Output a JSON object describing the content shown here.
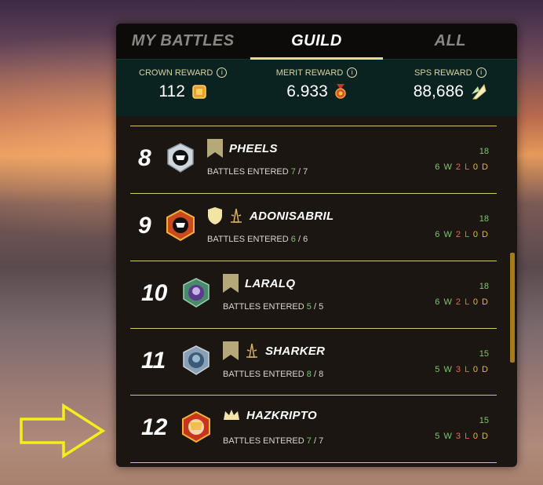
{
  "tabs": [
    {
      "label": "MY BATTLES"
    },
    {
      "label": "GUILD"
    },
    {
      "label": "ALL"
    }
  ],
  "rewards": {
    "crown": {
      "title": "CROWN REWARD",
      "value": "112"
    },
    "merit": {
      "title": "MERIT REWARD",
      "value": "6.933"
    },
    "sps": {
      "title": "SPS REWARD",
      "value": "88,686"
    }
  },
  "entered_label": "BATTLES ENTERED",
  "players": [
    {
      "rank": "8",
      "name": "PHEELS",
      "entered": "7",
      "total": "7",
      "score": "18",
      "w": "6 W",
      "l": "2 L",
      "d": "0 D"
    },
    {
      "rank": "9",
      "name": "ADONISABRIL",
      "entered": "6",
      "total": "6",
      "score": "18",
      "w": "6 W",
      "l": "2 L",
      "d": "0 D"
    },
    {
      "rank": "10",
      "name": "LARALQ",
      "entered": "5",
      "total": "5",
      "score": "18",
      "w": "6 W",
      "l": "2 L",
      "d": "0 D"
    },
    {
      "rank": "11",
      "name": "SHARKER",
      "entered": "8",
      "total": "8",
      "score": "15",
      "w": "5 W",
      "l": "3 L",
      "d": "0 D"
    },
    {
      "rank": "12",
      "name": "HAZKRIPTO",
      "entered": "7",
      "total": "7",
      "score": "15",
      "w": "5 W",
      "l": "3 L",
      "d": "0 D"
    }
  ],
  "colors": {
    "accent": "#f2d48a",
    "win": "#7ac96a",
    "loss": "#e06a55",
    "draw": "#e8b545",
    "arrow": "#f5ee1a"
  }
}
